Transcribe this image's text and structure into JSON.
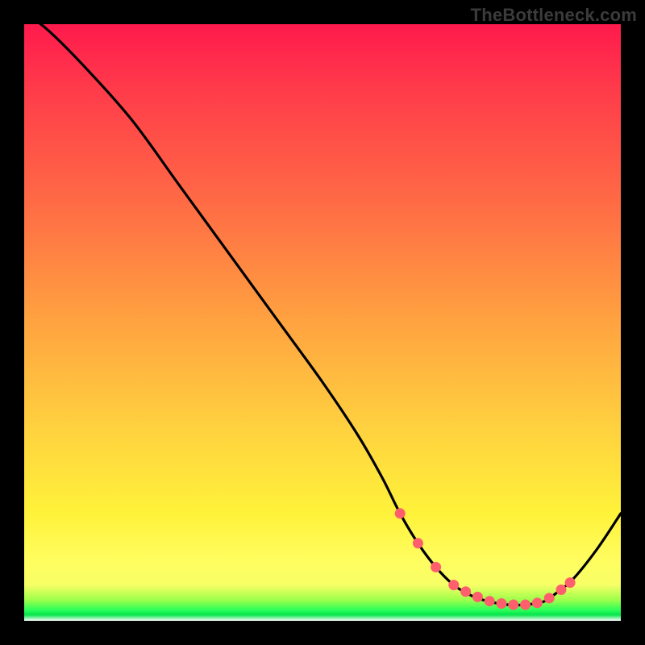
{
  "watermark": {
    "text": "TheBottleneck.com"
  },
  "chart_data": {
    "type": "line",
    "title": "",
    "xlabel": "",
    "ylabel": "",
    "xlim": [
      0,
      100
    ],
    "ylim": [
      0,
      100
    ],
    "series": [
      {
        "name": "curve",
        "x": [
          0,
          4,
          10,
          18,
          26,
          34,
          42,
          50,
          56,
          60,
          63,
          66,
          69,
          72,
          75,
          78,
          81,
          84,
          87,
          89,
          92,
          96,
          100
        ],
        "values": [
          102,
          99,
          93,
          84,
          73,
          62,
          51,
          40,
          31,
          24,
          18,
          13,
          9,
          6,
          4.2,
          3.2,
          2.7,
          2.7,
          3.2,
          4.5,
          7,
          12,
          18
        ]
      }
    ],
    "markers": {
      "name": "highlight-dots",
      "x": [
        63,
        66,
        69,
        72,
        74,
        76,
        78,
        80,
        82,
        84,
        86,
        88,
        90,
        91.5
      ],
      "values": [
        18,
        13,
        9,
        6,
        4.9,
        4.0,
        3.3,
        2.9,
        2.7,
        2.7,
        3.0,
        3.8,
        5.2,
        6.4
      ]
    },
    "colors": {
      "curve_stroke": "#000000",
      "marker_fill": "#ff5e6c",
      "gradient_top": "#ff1a4d",
      "gradient_mid": "#ffd23f",
      "gradient_bottom_green": "#2bff5a"
    }
  }
}
